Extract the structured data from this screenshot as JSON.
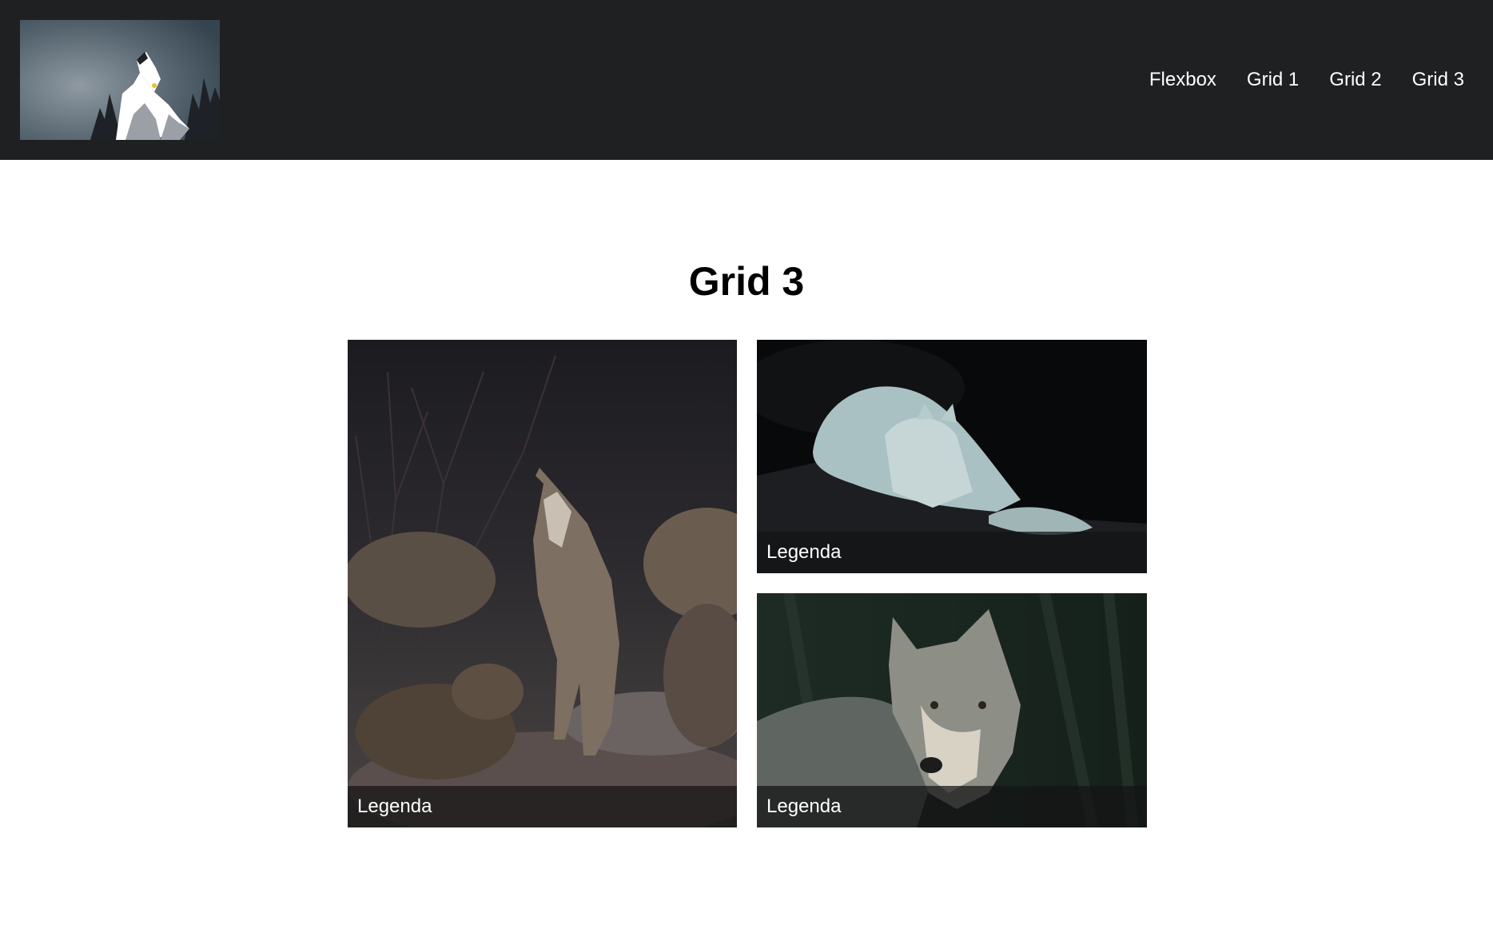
{
  "header": {
    "logo_icon": "howling-wolf-logo-icon",
    "background": "#1f2022",
    "nav": [
      {
        "label": "Flexbox"
      },
      {
        "label": "Grid 1"
      },
      {
        "label": "Grid 2"
      },
      {
        "label": "Grid 3"
      }
    ]
  },
  "main": {
    "title": "Grid 3",
    "cards": [
      {
        "caption": "Legenda",
        "image": "wolf-pack-howling-photo"
      },
      {
        "caption": "Legenda",
        "image": "white-wolf-resting-photo"
      },
      {
        "caption": "Legenda",
        "image": "grey-wolf-portrait-photo"
      }
    ]
  },
  "colors": {
    "header_bg": "#1f2022",
    "nav_text": "#ffffff",
    "caption_bg": "#141414"
  }
}
